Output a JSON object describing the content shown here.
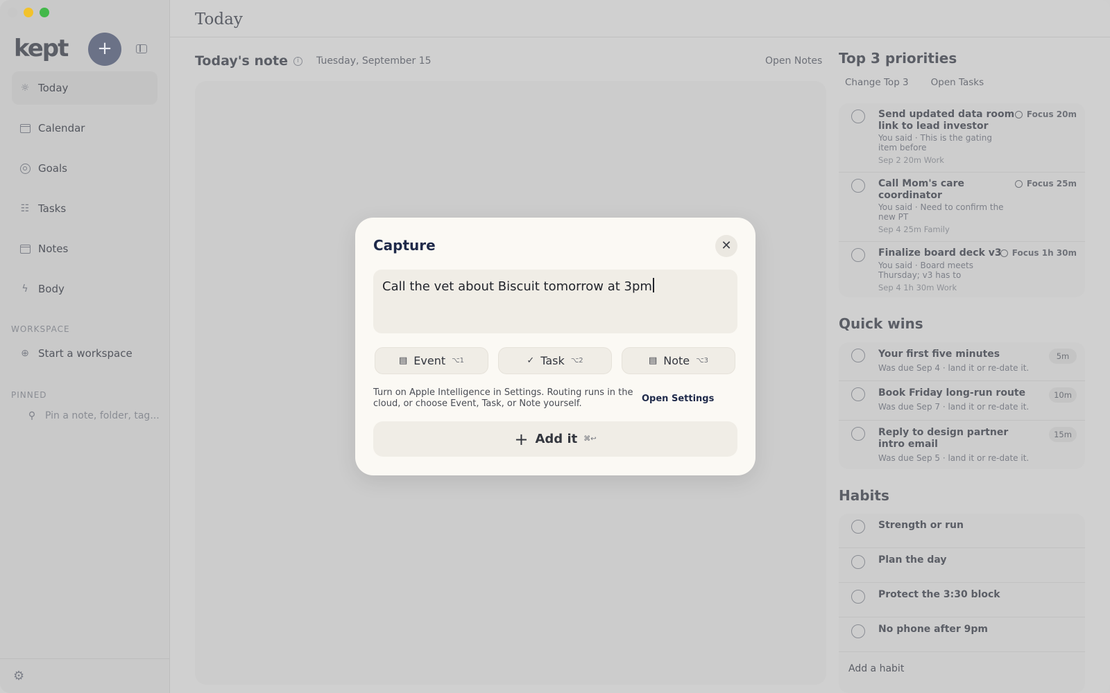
{
  "app": {
    "logo": "kept",
    "new_button": "+"
  },
  "sidebar": {
    "nav": [
      {
        "label": "Today",
        "icon": "sun-icon",
        "active": true
      },
      {
        "label": "Calendar",
        "icon": "calendar-icon"
      },
      {
        "label": "Goals",
        "icon": "target-icon"
      },
      {
        "label": "Tasks",
        "icon": "checklist-icon"
      },
      {
        "label": "Notes",
        "icon": "note-icon"
      },
      {
        "label": "Body",
        "icon": "bolt-icon"
      }
    ],
    "workspace_label": "WORKSPACE",
    "workspace_item": "Start a workspace",
    "pinned_label": "PINNED",
    "pinned_placeholder": "Pin a note, folder, tag..."
  },
  "main": {
    "title": "Today",
    "note_title": "Today's note",
    "note_date": "Tuesday, September 15",
    "open_notes": "Open Notes"
  },
  "priorities": {
    "heading": "Top 3 priorities",
    "change_link": "Change Top 3",
    "open_tasks_link": "Open Tasks",
    "items": [
      {
        "title_l1": "Send updated data room",
        "title_l2": "link to lead investor",
        "sub_l1": "You said · This is the gating",
        "sub_l2": "item before",
        "meta": "Sep 2  20m  Work",
        "focus": "Focus 20m"
      },
      {
        "title_l1": "Call Mom's care",
        "title_l2": "coordinator",
        "sub_l1": "You said · Need to confirm the",
        "sub_l2": "new PT",
        "meta": "Sep 4  25m  Family",
        "focus": "Focus 25m"
      },
      {
        "title_l1": "Finalize board deck v3",
        "title_l2": "",
        "sub_l1": "You said · Board meets",
        "sub_l2": "Thursday; v3 has to",
        "meta": "Sep 4  1h 30m  Work",
        "focus": "Focus 1h 30m"
      }
    ]
  },
  "quick_wins": {
    "heading": "Quick wins",
    "items": [
      {
        "title_l1": "Your first five minutes",
        "title_l2": "",
        "sub": "Was due Sep 4 · land it or re-date it.",
        "pill": "5m"
      },
      {
        "title_l1": "Book Friday long-run route",
        "title_l2": "",
        "sub": "Was due Sep 7 · land it or re-date it.",
        "pill": "10m"
      },
      {
        "title_l1": "Reply to design partner",
        "title_l2": "intro email",
        "sub": "Was due Sep 5 · land it or re-date it.",
        "pill": "15m"
      }
    ]
  },
  "habits": {
    "heading": "Habits",
    "items": [
      "Strength or run",
      "Plan the day",
      "Protect the 3:30 block",
      "No phone after 9pm"
    ],
    "add_label": "Add a habit"
  },
  "capture": {
    "title": "Capture",
    "close": "✕",
    "input_value": "Call the vet about Biscuit tomorrow at 3pm",
    "types": [
      {
        "label": "Event",
        "shortcut": "⌥1",
        "icon": "calendar-icon"
      },
      {
        "label": "Task",
        "shortcut": "⌥2",
        "icon": "check-circle-icon"
      },
      {
        "label": "Note",
        "shortcut": "⌥3",
        "icon": "note-icon"
      }
    ],
    "hint_l1": "Turn on Apple Intelligence in Settings. Routing runs in the",
    "hint_l2": "cloud, or choose Event, Task, or Note yourself.",
    "open_settings": "Open Settings",
    "add_label": "Add it",
    "add_shortcut": "⌘↩"
  },
  "colors": {
    "accent": "#1f2a4a",
    "modal_bg": "#fbf9f4",
    "scrim": "#cfcfcf"
  }
}
